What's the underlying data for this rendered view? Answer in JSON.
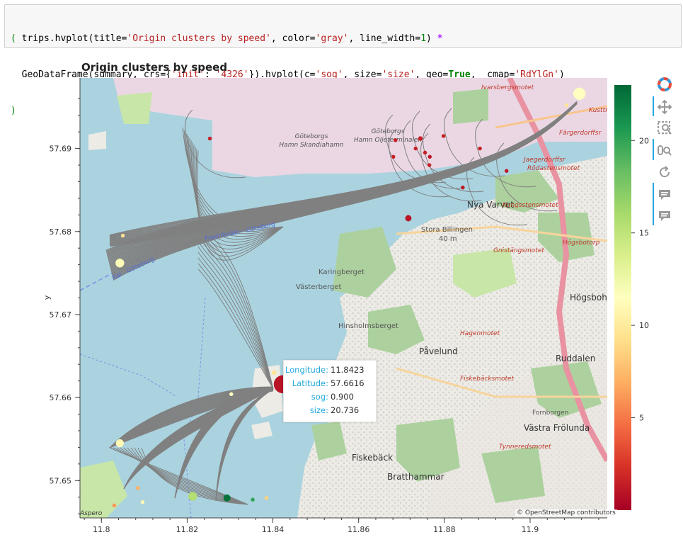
{
  "code_cell": {
    "line1_parts": [
      "( trips.hvplot(title=",
      "'Origin clusters by speed'",
      ", color=",
      "'gray'",
      ", line_width=",
      "1",
      ") ",
      "*"
    ],
    "line2_parts": [
      "  GeoDataFrame(summary, crs={",
      "'init'",
      ": ",
      "'4326'",
      "}).hvplot(c=",
      "'sog'",
      ", size=",
      "'size'",
      ", geo=",
      "True",
      ",  cmap=",
      "'RdYlGn'",
      ")"
    ],
    "line3": ")"
  },
  "plot": {
    "title": "Origin clusters by speed",
    "ylabel": "y",
    "attribution": "© OpenStreetMap contributors",
    "colorbar_ticks": [
      "20",
      "15",
      "10",
      "5"
    ],
    "cmap": "RdYlGn"
  },
  "map_labels": [
    "Ivarsbergsmotet",
    "Kusttr",
    "Färgerdorffsr",
    "Jaegerdorffsr",
    "Rödastensmotet",
    "Göteborgs Hamn Skandiahamn",
    "Göteborgs Hamn Oljeterminalen",
    "Nya Varvet",
    "Kungsstensmotet",
    "Stora Billingen",
    "40 m",
    "Gnistängsmotet",
    "Högsbotorp",
    "Karingberget",
    "Västerberget",
    "Hinsholmsberget",
    "Högsboh",
    "Hagenmotet",
    "Påvelund",
    "Ruddalen",
    "Fiskebäcksmotet",
    "Fornborgen",
    "Västra Frölunda",
    "Tynneredsmotet",
    "Fiskebäck",
    "Bratthammar",
    "Aspero",
    "Fredriksdal – Göteborg",
    "Kal - Göteborg"
  ],
  "chart_data": {
    "type": "scatter",
    "title": "Origin clusters by speed",
    "xlabel": "",
    "ylabel": "y",
    "xlim": [
      11.795,
      11.918
    ],
    "ylim": [
      57.6455,
      57.6985
    ],
    "x_ticks": [
      "11.8",
      "11.82",
      "11.84",
      "11.86",
      "11.88",
      "11.9"
    ],
    "y_ticks": [
      "57.65",
      "57.66",
      "57.67",
      "57.68",
      "57.69"
    ],
    "color_field": "sog",
    "size_field": "size",
    "colorbar_ticks": [
      5,
      10,
      15,
      20
    ],
    "colorbar_range": [
      0,
      23
    ],
    "points": [
      {
        "x": 11.9115,
        "y": 57.6966,
        "sog": 11.5,
        "size": 14
      },
      {
        "x": 11.9085,
        "y": 57.6952,
        "sog": 9.5,
        "size": 3
      },
      {
        "x": 11.8043,
        "y": 57.6762,
        "sog": 11.2,
        "size": 10
      },
      {
        "x": 11.805,
        "y": 57.6795,
        "sog": 9.5,
        "size": 3
      },
      {
        "x": 11.8043,
        "y": 57.6545,
        "sog": 11.0,
        "size": 9
      },
      {
        "x": 11.8423,
        "y": 57.6616,
        "sog": 0.9,
        "size": 20.736
      },
      {
        "x": 11.8403,
        "y": 57.663,
        "sog": 9.5,
        "size": 5
      },
      {
        "x": 11.8303,
        "y": 57.6604,
        "sog": 11.5,
        "size": 3
      },
      {
        "x": 11.8213,
        "y": 57.6481,
        "sog": 15.5,
        "size": 10
      },
      {
        "x": 11.8293,
        "y": 57.6479,
        "sog": 22.5,
        "size": 8
      },
      {
        "x": 11.8353,
        "y": 57.6477,
        "sog": 20.0,
        "size": 3
      },
      {
        "x": 11.8385,
        "y": 57.6479,
        "sog": 8.5,
        "size": 4
      },
      {
        "x": 11.8085,
        "y": 57.6491,
        "sog": 7.0,
        "size": 3
      },
      {
        "x": 11.8096,
        "y": 57.6474,
        "sog": 11.0,
        "size": 4
      },
      {
        "x": 11.803,
        "y": 57.647,
        "sog": 6.0,
        "size": 3
      },
      {
        "x": 11.8253,
        "y": 57.6912,
        "sog": 1.5,
        "size": 4
      },
      {
        "x": 11.8716,
        "y": 57.6816,
        "sog": 1.0,
        "size": 7
      },
      {
        "x": 11.8686,
        "y": 57.691,
        "sog": 1.5,
        "size": 4
      },
      {
        "x": 11.8744,
        "y": 57.6912,
        "sog": 1.5,
        "size": 5
      },
      {
        "x": 11.8755,
        "y": 57.6895,
        "sog": 1.5,
        "size": 3
      },
      {
        "x": 11.8733,
        "y": 57.69,
        "sog": 1.5,
        "size": 4
      },
      {
        "x": 11.8766,
        "y": 57.689,
        "sog": 1.0,
        "size": 4
      },
      {
        "x": 11.8681,
        "y": 57.689,
        "sog": 1.5,
        "size": 3
      },
      {
        "x": 11.8765,
        "y": 57.688,
        "sog": 1.5,
        "size": 3
      },
      {
        "x": 11.8798,
        "y": 57.6915,
        "sog": 1.5,
        "size": 3
      },
      {
        "x": 11.8883,
        "y": 57.69,
        "sog": 1.5,
        "size": 3
      },
      {
        "x": 11.8945,
        "y": 57.6873,
        "sog": 1.2,
        "size": 4
      },
      {
        "x": 11.8843,
        "y": 57.6853,
        "sog": 1.2,
        "size": 4
      }
    ]
  },
  "tooltip": {
    "rows": [
      {
        "key": "Longitude:",
        "value": "11.8423"
      },
      {
        "key": "Latitude:",
        "value": "57.6616"
      },
      {
        "key": "sog:",
        "value": "0.900"
      },
      {
        "key": "size:",
        "value": "20.736"
      }
    ]
  },
  "toolbar": {
    "icons": [
      "bokeh-logo-icon",
      "pan-icon",
      "box-zoom-icon",
      "wheel-zoom-icon",
      "reset-icon",
      "hover-icon",
      "hover-icon-2"
    ]
  }
}
